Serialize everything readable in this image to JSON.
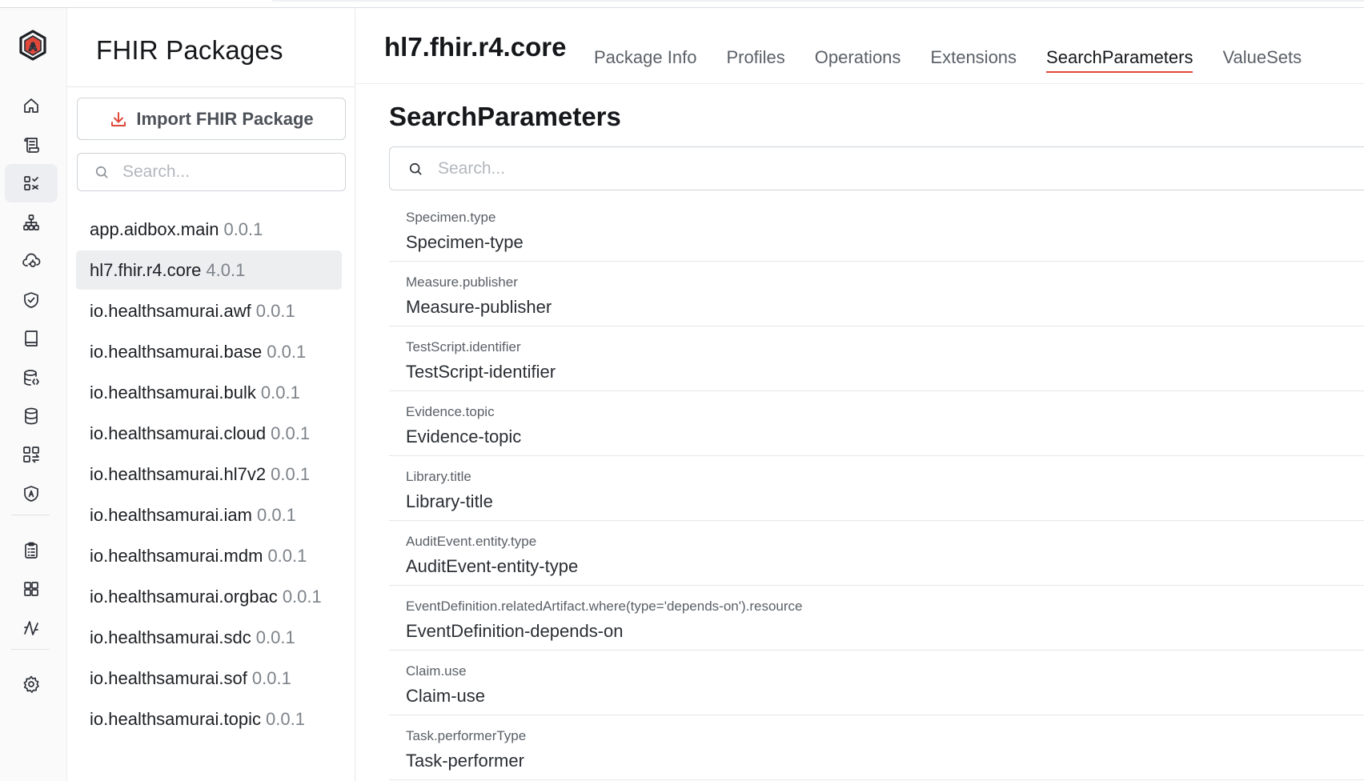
{
  "rail": {
    "logo": "aidbox-logo",
    "items": [
      {
        "icon": "home-icon"
      },
      {
        "icon": "scroll-icon"
      },
      {
        "icon": "packages-icon",
        "active": true
      },
      {
        "icon": "hierarchy-icon"
      },
      {
        "icon": "cloud-sync-icon"
      },
      {
        "icon": "shield-check-icon"
      },
      {
        "icon": "book-icon"
      },
      {
        "icon": "database-code-icon"
      },
      {
        "icon": "database-icon"
      },
      {
        "icon": "apps-transfer-icon"
      },
      {
        "icon": "shield-a-icon"
      },
      {
        "icon": "clipboard-icon"
      },
      {
        "icon": "grid-icon"
      },
      {
        "icon": "activity-icon"
      },
      {
        "icon": "gear-icon"
      }
    ]
  },
  "packages": {
    "title": "FHIR Packages",
    "import_label": "Import FHIR Package",
    "search_placeholder": "Search...",
    "items": [
      {
        "name": "app.aidbox.main",
        "version": "0.0.1"
      },
      {
        "name": "hl7.fhir.r4.core",
        "version": "4.0.1",
        "active": true
      },
      {
        "name": "io.healthsamurai.awf",
        "version": "0.0.1"
      },
      {
        "name": "io.healthsamurai.base",
        "version": "0.0.1"
      },
      {
        "name": "io.healthsamurai.bulk",
        "version": "0.0.1"
      },
      {
        "name": "io.healthsamurai.cloud",
        "version": "0.0.1"
      },
      {
        "name": "io.healthsamurai.hl7v2",
        "version": "0.0.1"
      },
      {
        "name": "io.healthsamurai.iam",
        "version": "0.0.1"
      },
      {
        "name": "io.healthsamurai.mdm",
        "version": "0.0.1"
      },
      {
        "name": "io.healthsamurai.orgbac",
        "version": "0.0.1"
      },
      {
        "name": "io.healthsamurai.sdc",
        "version": "0.0.1"
      },
      {
        "name": "io.healthsamurai.sof",
        "version": "0.0.1"
      },
      {
        "name": "io.healthsamurai.topic",
        "version": "0.0.1"
      }
    ]
  },
  "main": {
    "package_name": "hl7.fhir.r4.core",
    "tabs": [
      {
        "label": "Package Info"
      },
      {
        "label": "Profiles"
      },
      {
        "label": "Operations"
      },
      {
        "label": "Extensions"
      },
      {
        "label": "SearchParameters",
        "active": true
      },
      {
        "label": "ValueSets"
      }
    ],
    "section_title": "SearchParameters",
    "search_placeholder": "Search...",
    "accent_color": "#e0483a",
    "search_params": [
      {
        "expression": "Specimen.type",
        "name": "Specimen-type"
      },
      {
        "expression": "Measure.publisher",
        "name": "Measure-publisher"
      },
      {
        "expression": "TestScript.identifier",
        "name": "TestScript-identifier"
      },
      {
        "expression": "Evidence.topic",
        "name": "Evidence-topic"
      },
      {
        "expression": "Library.title",
        "name": "Library-title"
      },
      {
        "expression": "AuditEvent.entity.type",
        "name": "AuditEvent-entity-type"
      },
      {
        "expression": "EventDefinition.relatedArtifact.where(type='depends-on').resource",
        "name": "EventDefinition-depends-on"
      },
      {
        "expression": "Claim.use",
        "name": "Claim-use"
      },
      {
        "expression": "Task.performerType",
        "name": "Task-performer"
      }
    ]
  }
}
